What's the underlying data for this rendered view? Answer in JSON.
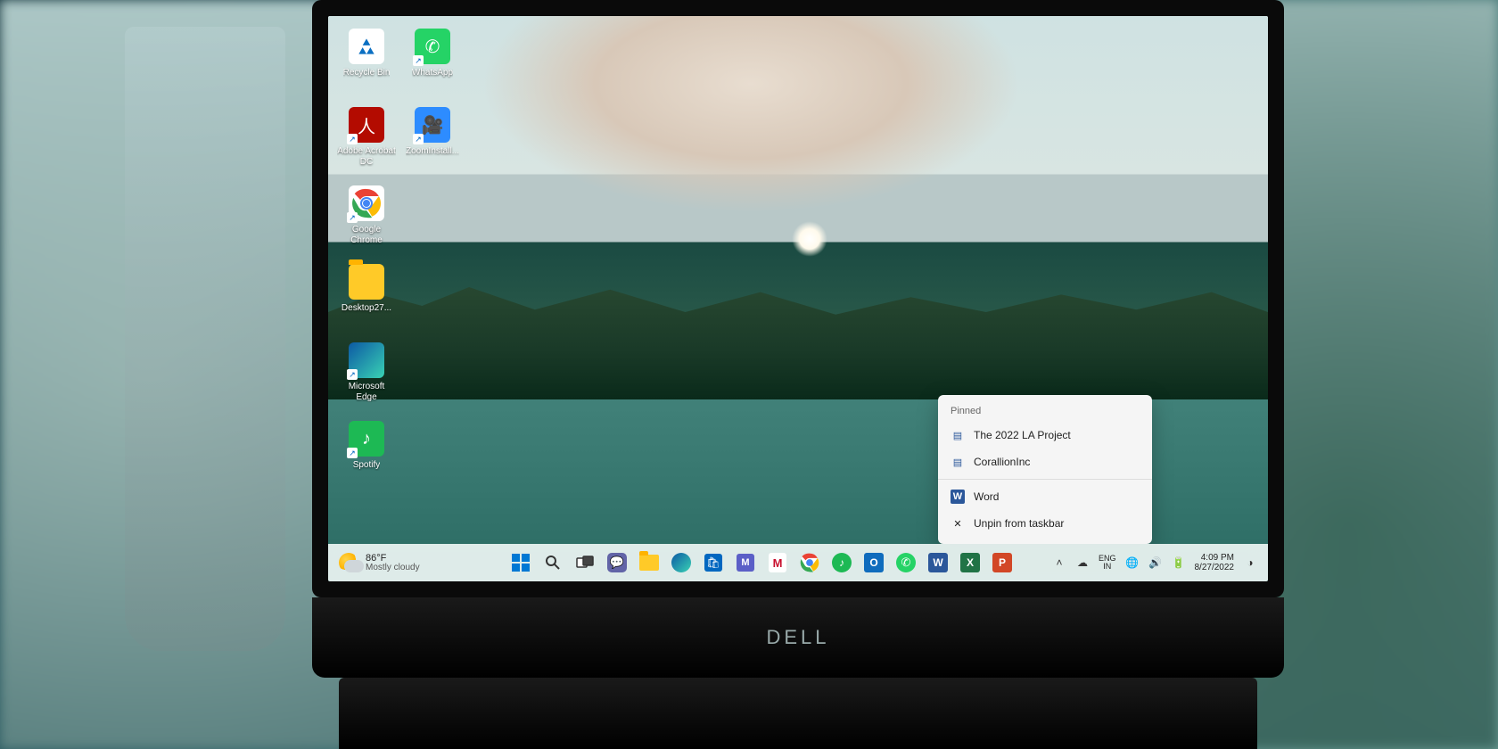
{
  "desktop_icons": [
    {
      "label": "Recycle Bin",
      "icon": "recycle-bin-icon"
    },
    {
      "label": "WhatsApp",
      "icon": "whatsapp-icon"
    },
    {
      "label": "Adobe Acrobat DC",
      "icon": "acrobat-icon"
    },
    {
      "label": "ZoomInstall...",
      "icon": "zoom-icon"
    },
    {
      "label": "Google Chrome",
      "icon": "chrome-icon"
    },
    {
      "label": "",
      "icon": ""
    },
    {
      "label": "Desktop27...",
      "icon": "folder-icon"
    },
    {
      "label": "",
      "icon": ""
    },
    {
      "label": "Microsoft Edge",
      "icon": "edge-icon"
    },
    {
      "label": "",
      "icon": ""
    },
    {
      "label": "Spotify",
      "icon": "spotify-icon"
    }
  ],
  "jumplist": {
    "header": "Pinned",
    "pinned": [
      {
        "label": "The 2022 LA Project",
        "icon": "word-doc-icon"
      },
      {
        "label": "CorallionInc",
        "icon": "word-doc-icon"
      }
    ],
    "app": {
      "label": "Word",
      "icon": "word-icon"
    },
    "unpin": {
      "label": "Unpin from taskbar",
      "icon": "unpin-icon"
    }
  },
  "taskbar": {
    "weather": {
      "temp": "86°F",
      "status": "Mostly cloudy"
    },
    "center_icons": [
      "start-icon",
      "search-icon",
      "task-view-icon",
      "chat-icon",
      "explorer-icon",
      "edge-icon",
      "store-icon",
      "mail-icon",
      "mcafee-icon",
      "chrome-icon",
      "spotify-icon",
      "outlook-icon",
      "whatsapp-icon",
      "word-icon",
      "excel-icon",
      "powerpoint-icon"
    ],
    "tray": {
      "chevron": "˄",
      "onedrive": "☁",
      "lang_top": "ENG",
      "lang_bottom": "IN",
      "net": "🌐",
      "vol": "🔊",
      "bat": "🔋"
    },
    "clock": {
      "time": "4:09 PM",
      "date": "8/27/2022"
    }
  },
  "laptop_brand": "DELL"
}
